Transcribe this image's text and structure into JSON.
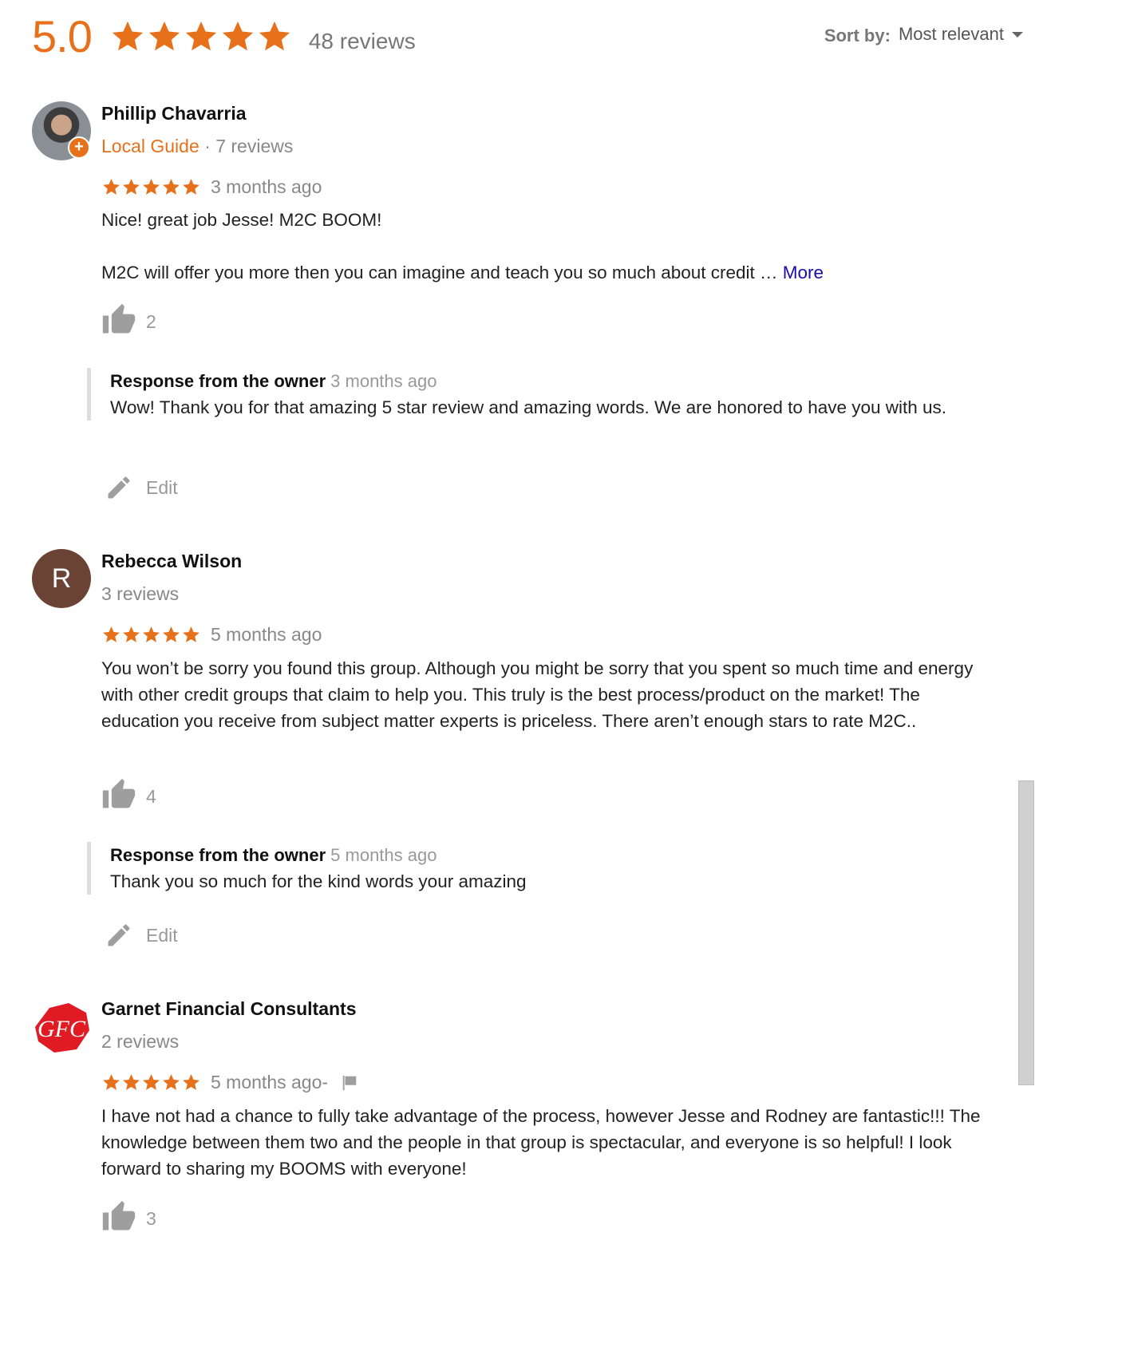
{
  "summary": {
    "rating": "5.0",
    "stars": 5,
    "review_count": "48 reviews"
  },
  "sort": {
    "label": "Sort by:",
    "value": "Most relevant"
  },
  "colors": {
    "star": "#e7711b",
    "link": "#1a0dab",
    "muted": "#888888"
  },
  "reviews": [
    {
      "name": "Phillip Chavarria",
      "local_guide": "Local Guide",
      "meta_sep": " · ",
      "review_count": "7 reviews",
      "stars": 5,
      "time": "3 months ago",
      "text": [
        "Nice! great job Jesse! M2C BOOM!",
        "M2C will offer you more then you can imagine and teach you so much about credit … "
      ],
      "more": "More",
      "likes": "2",
      "owner_label": "Response from the owner",
      "owner_time": "3 months ago",
      "owner_text": "Wow! Thank you for that amazing 5 star review and amazing words. We are honored to have you with us.",
      "edit": "Edit"
    },
    {
      "name": "Rebecca Wilson",
      "avatar_letter": "R",
      "review_count": "3 reviews",
      "stars": 5,
      "time": "5 months ago",
      "text": "You won’t be sorry you found this group. Although you might be sorry that you spent so much time and energy with other credit groups that claim to help you. This truly is the best process/product on the market! The education you receive from subject matter experts is priceless. There aren’t enough stars to rate M2C..",
      "likes": "4",
      "owner_label": "Response from the owner",
      "owner_time": "5 months ago",
      "owner_text": "Thank you so much for the kind words your amazing",
      "edit": "Edit"
    },
    {
      "name": "Garnet Financial Consultants",
      "avatar_logo": "GFC",
      "review_count": "2 reviews",
      "stars": 5,
      "time": "5 months ago",
      "time_sep": " - ",
      "text": "I have not had a chance to fully take advantage of the process, however Jesse and Rodney are fantastic!!!  The knowledge between them two and the people in that group is spectacular, and everyone is so helpful!  I look forward to sharing my BOOMS with everyone!",
      "likes": "3"
    }
  ]
}
